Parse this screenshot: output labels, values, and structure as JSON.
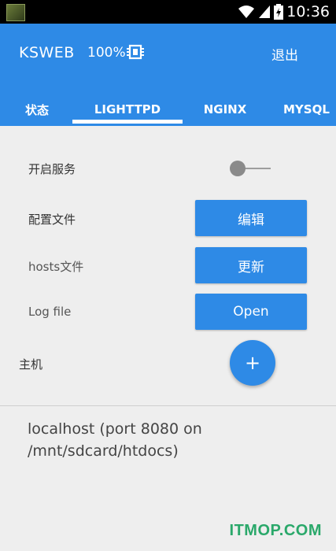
{
  "status_bar": {
    "time": "10:36",
    "icons": [
      "notification-thumbnail-icon",
      "wifi-icon",
      "signal-icon",
      "battery-icon"
    ]
  },
  "app_bar": {
    "title": "KSWEB",
    "battery_percent": "100%",
    "chip_icon": "cpu-chip-icon",
    "exit_label": "退出"
  },
  "tabs": {
    "items": [
      {
        "label": "状态"
      },
      {
        "label": "LIGHTTPD"
      },
      {
        "label": "NGINX"
      },
      {
        "label": "MYSQL"
      }
    ],
    "selected": 1
  },
  "settings": {
    "service_label": "开启服务",
    "service_enabled": false,
    "config_label": "配置文件",
    "config_button": "编辑",
    "hosts_label": "hosts文件",
    "hosts_button": "更新",
    "log_label": "Log file",
    "log_button": "Open",
    "host_label": "主机",
    "add_host_symbol": "+"
  },
  "hosts": [
    {
      "text": "localhost (port 8080 on /mnt/sdcard/htdocs)"
    }
  ],
  "watermark": "ITMOP.COM",
  "colors": {
    "primary": "#2e8ae6",
    "background": "#eeeeee",
    "status_bar": "#000000",
    "watermark": "#2aa86a"
  }
}
